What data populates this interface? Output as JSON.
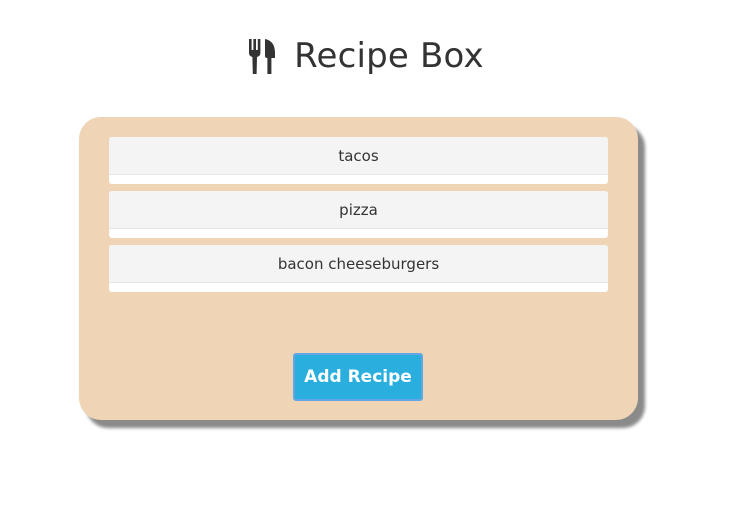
{
  "header": {
    "title": "Recipe Box",
    "icon": "cutlery-icon"
  },
  "recipes": [
    {
      "name": "tacos"
    },
    {
      "name": "pizza"
    },
    {
      "name": "bacon cheeseburgers"
    }
  ],
  "actions": {
    "add_label": "Add Recipe"
  },
  "colors": {
    "box_background": "#efd5b5",
    "button_background": "#2aaede",
    "button_border": "#63a6e6",
    "item_background": "#f4f4f4",
    "text": "#333333"
  }
}
